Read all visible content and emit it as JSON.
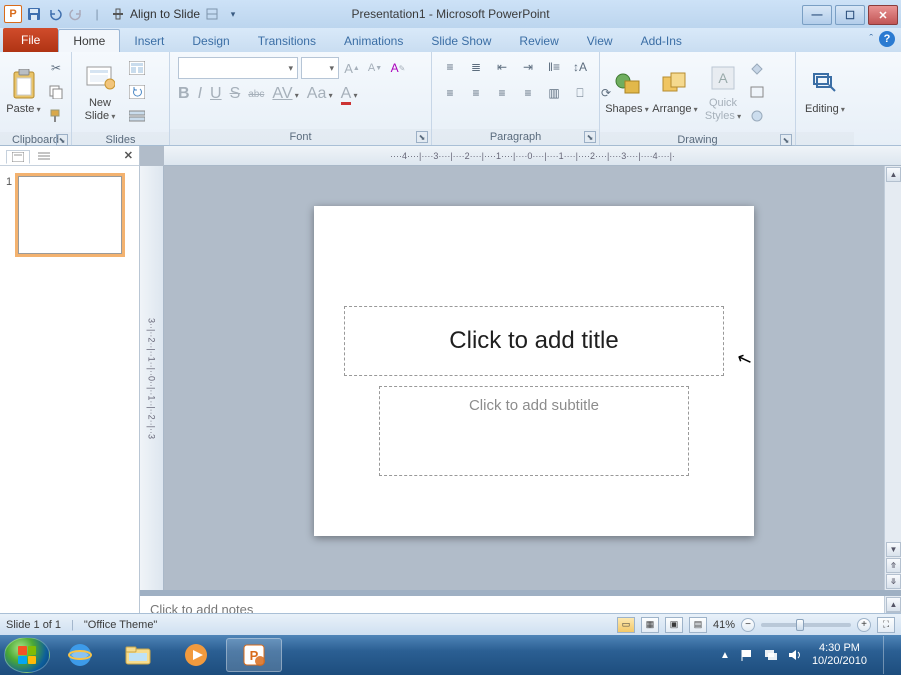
{
  "titlebar": {
    "app_icon_letter": "P",
    "align_label": "Align to Slide",
    "title": "Presentation1 - Microsoft PowerPoint"
  },
  "tabs": {
    "file": "File",
    "home": "Home",
    "insert": "Insert",
    "design": "Design",
    "transitions": "Transitions",
    "animations": "Animations",
    "slideshow": "Slide Show",
    "review": "Review",
    "view": "View",
    "addins": "Add-Ins"
  },
  "ribbon": {
    "clipboard": {
      "label": "Clipboard",
      "paste": "Paste"
    },
    "slides": {
      "label": "Slides",
      "new_slide": "New\nSlide"
    },
    "font": {
      "label": "Font",
      "font_name_placeholder": "",
      "font_size_placeholder": "",
      "bold": "B",
      "italic": "I",
      "underline": "U",
      "strike": "S",
      "shadow": "abc",
      "charspace": "AV",
      "changecase": "Aa",
      "clear": "A"
    },
    "paragraph": {
      "label": "Paragraph"
    },
    "drawing": {
      "label": "Drawing",
      "shapes": "Shapes",
      "arrange": "Arrange",
      "quick_styles": "Quick\nStyles"
    },
    "editing": {
      "label": "Editing",
      "btn": "Editing"
    }
  },
  "thumbnails": {
    "close": "✕",
    "slide1_num": "1"
  },
  "ruler": {
    "h_ticks": "····4····|····3····|····2····|····1····|····0····|····1····|····2····|····3····|····4····|·",
    "v_ticks": "3··|··2··|··1··|··0··|··1··|··2··|··3"
  },
  "slide": {
    "title_placeholder": "Click to add title",
    "subtitle_placeholder": "Click to add subtitle"
  },
  "notes": {
    "placeholder": "Click to add notes"
  },
  "statusbar": {
    "slide_info": "Slide 1 of 1",
    "theme": "\"Office Theme\"",
    "zoom": "41%"
  },
  "taskbar": {
    "time": "4:30 PM",
    "date": "10/20/2010"
  }
}
